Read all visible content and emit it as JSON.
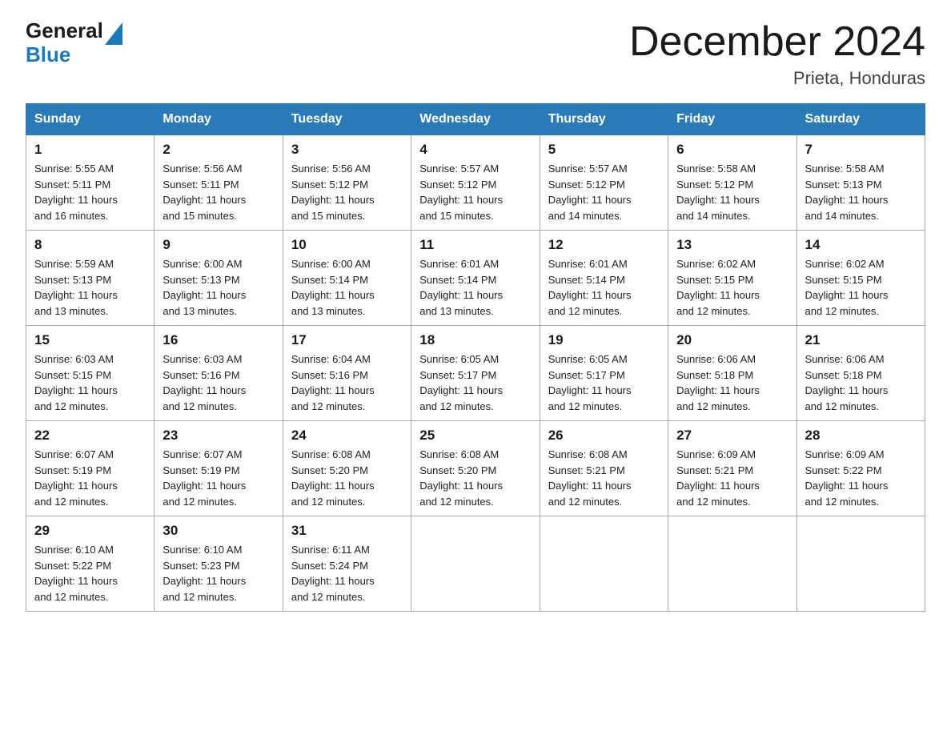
{
  "logo": {
    "general": "General",
    "blue": "Blue"
  },
  "title": "December 2024",
  "subtitle": "Prieta, Honduras",
  "days_of_week": [
    "Sunday",
    "Monday",
    "Tuesday",
    "Wednesday",
    "Thursday",
    "Friday",
    "Saturday"
  ],
  "weeks": [
    [
      {
        "day": "1",
        "info": "Sunrise: 5:55 AM\nSunset: 5:11 PM\nDaylight: 11 hours\nand 16 minutes."
      },
      {
        "day": "2",
        "info": "Sunrise: 5:56 AM\nSunset: 5:11 PM\nDaylight: 11 hours\nand 15 minutes."
      },
      {
        "day": "3",
        "info": "Sunrise: 5:56 AM\nSunset: 5:12 PM\nDaylight: 11 hours\nand 15 minutes."
      },
      {
        "day": "4",
        "info": "Sunrise: 5:57 AM\nSunset: 5:12 PM\nDaylight: 11 hours\nand 15 minutes."
      },
      {
        "day": "5",
        "info": "Sunrise: 5:57 AM\nSunset: 5:12 PM\nDaylight: 11 hours\nand 14 minutes."
      },
      {
        "day": "6",
        "info": "Sunrise: 5:58 AM\nSunset: 5:12 PM\nDaylight: 11 hours\nand 14 minutes."
      },
      {
        "day": "7",
        "info": "Sunrise: 5:58 AM\nSunset: 5:13 PM\nDaylight: 11 hours\nand 14 minutes."
      }
    ],
    [
      {
        "day": "8",
        "info": "Sunrise: 5:59 AM\nSunset: 5:13 PM\nDaylight: 11 hours\nand 13 minutes."
      },
      {
        "day": "9",
        "info": "Sunrise: 6:00 AM\nSunset: 5:13 PM\nDaylight: 11 hours\nand 13 minutes."
      },
      {
        "day": "10",
        "info": "Sunrise: 6:00 AM\nSunset: 5:14 PM\nDaylight: 11 hours\nand 13 minutes."
      },
      {
        "day": "11",
        "info": "Sunrise: 6:01 AM\nSunset: 5:14 PM\nDaylight: 11 hours\nand 13 minutes."
      },
      {
        "day": "12",
        "info": "Sunrise: 6:01 AM\nSunset: 5:14 PM\nDaylight: 11 hours\nand 12 minutes."
      },
      {
        "day": "13",
        "info": "Sunrise: 6:02 AM\nSunset: 5:15 PM\nDaylight: 11 hours\nand 12 minutes."
      },
      {
        "day": "14",
        "info": "Sunrise: 6:02 AM\nSunset: 5:15 PM\nDaylight: 11 hours\nand 12 minutes."
      }
    ],
    [
      {
        "day": "15",
        "info": "Sunrise: 6:03 AM\nSunset: 5:15 PM\nDaylight: 11 hours\nand 12 minutes."
      },
      {
        "day": "16",
        "info": "Sunrise: 6:03 AM\nSunset: 5:16 PM\nDaylight: 11 hours\nand 12 minutes."
      },
      {
        "day": "17",
        "info": "Sunrise: 6:04 AM\nSunset: 5:16 PM\nDaylight: 11 hours\nand 12 minutes."
      },
      {
        "day": "18",
        "info": "Sunrise: 6:05 AM\nSunset: 5:17 PM\nDaylight: 11 hours\nand 12 minutes."
      },
      {
        "day": "19",
        "info": "Sunrise: 6:05 AM\nSunset: 5:17 PM\nDaylight: 11 hours\nand 12 minutes."
      },
      {
        "day": "20",
        "info": "Sunrise: 6:06 AM\nSunset: 5:18 PM\nDaylight: 11 hours\nand 12 minutes."
      },
      {
        "day": "21",
        "info": "Sunrise: 6:06 AM\nSunset: 5:18 PM\nDaylight: 11 hours\nand 12 minutes."
      }
    ],
    [
      {
        "day": "22",
        "info": "Sunrise: 6:07 AM\nSunset: 5:19 PM\nDaylight: 11 hours\nand 12 minutes."
      },
      {
        "day": "23",
        "info": "Sunrise: 6:07 AM\nSunset: 5:19 PM\nDaylight: 11 hours\nand 12 minutes."
      },
      {
        "day": "24",
        "info": "Sunrise: 6:08 AM\nSunset: 5:20 PM\nDaylight: 11 hours\nand 12 minutes."
      },
      {
        "day": "25",
        "info": "Sunrise: 6:08 AM\nSunset: 5:20 PM\nDaylight: 11 hours\nand 12 minutes."
      },
      {
        "day": "26",
        "info": "Sunrise: 6:08 AM\nSunset: 5:21 PM\nDaylight: 11 hours\nand 12 minutes."
      },
      {
        "day": "27",
        "info": "Sunrise: 6:09 AM\nSunset: 5:21 PM\nDaylight: 11 hours\nand 12 minutes."
      },
      {
        "day": "28",
        "info": "Sunrise: 6:09 AM\nSunset: 5:22 PM\nDaylight: 11 hours\nand 12 minutes."
      }
    ],
    [
      {
        "day": "29",
        "info": "Sunrise: 6:10 AM\nSunset: 5:22 PM\nDaylight: 11 hours\nand 12 minutes."
      },
      {
        "day": "30",
        "info": "Sunrise: 6:10 AM\nSunset: 5:23 PM\nDaylight: 11 hours\nand 12 minutes."
      },
      {
        "day": "31",
        "info": "Sunrise: 6:11 AM\nSunset: 5:24 PM\nDaylight: 11 hours\nand 12 minutes."
      },
      null,
      null,
      null,
      null
    ]
  ]
}
